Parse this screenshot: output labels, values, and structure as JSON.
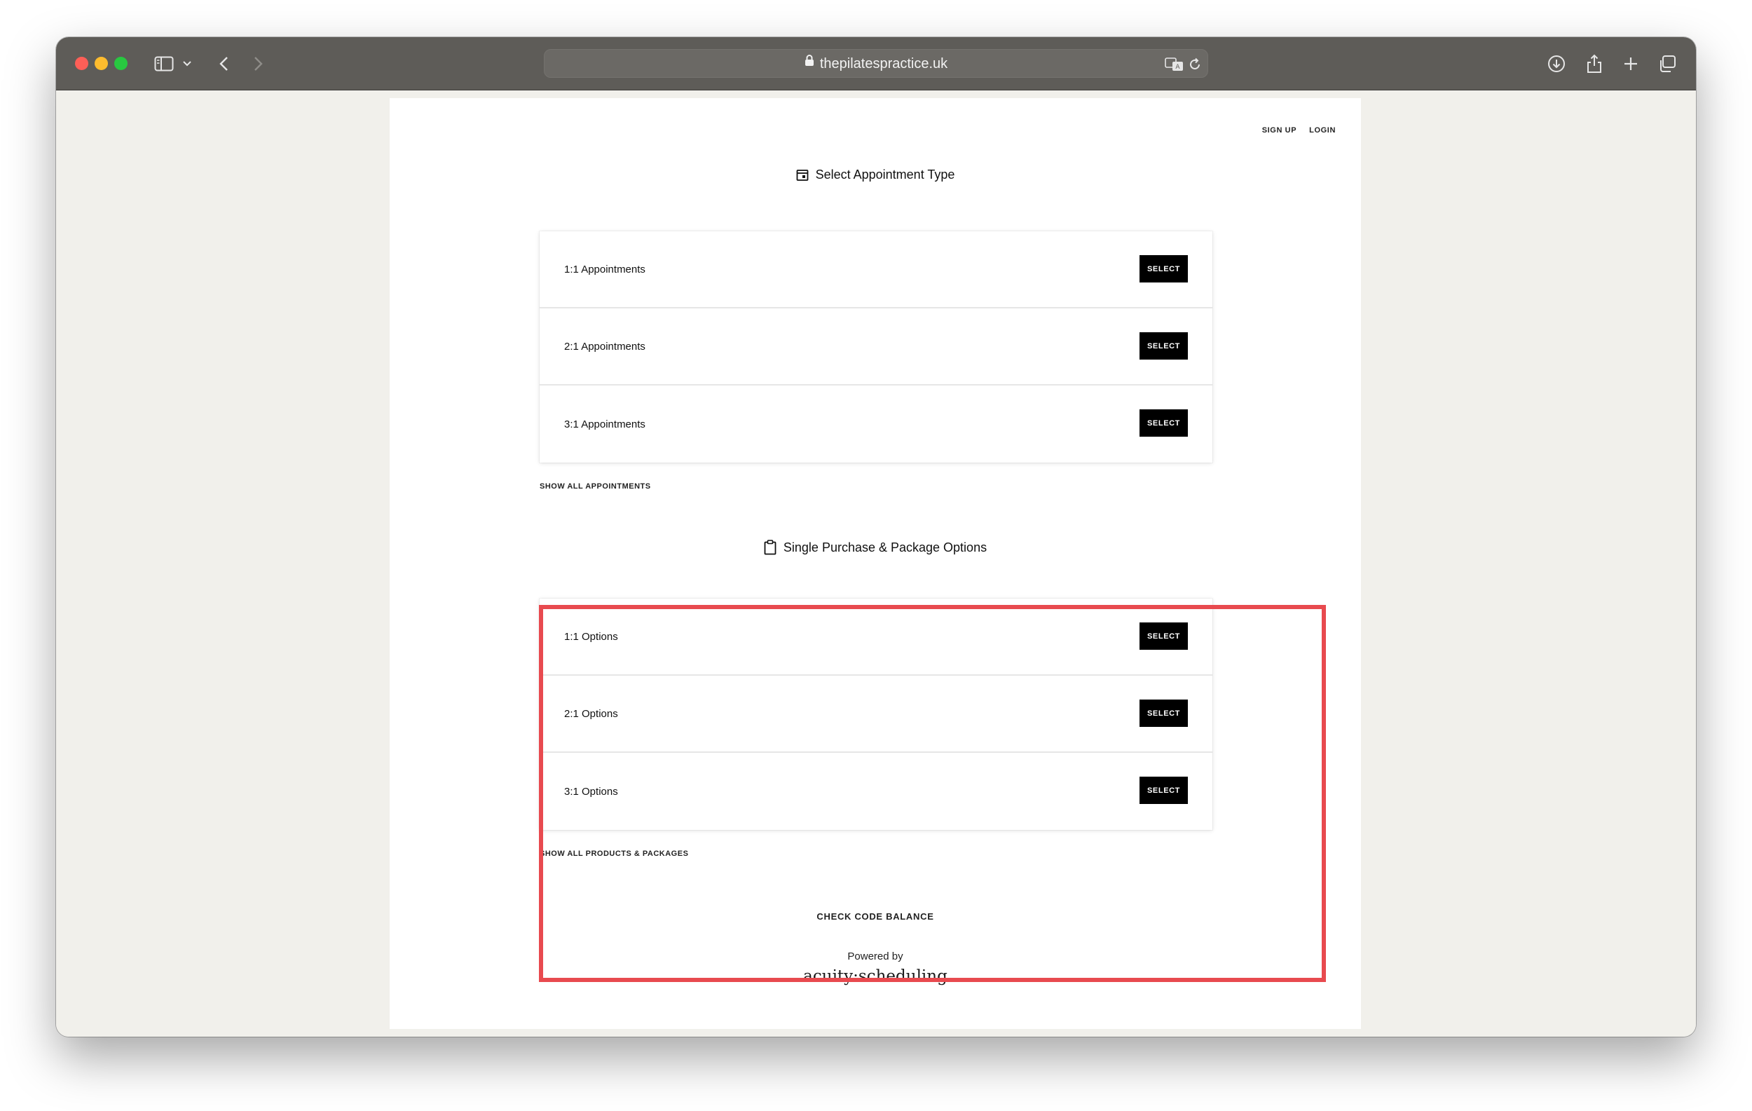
{
  "browser": {
    "url": "thepilatespractice.uk"
  },
  "header": {
    "sign_up": "SIGN UP",
    "login": "LOGIN"
  },
  "appointments": {
    "title": "Select Appointment Type",
    "items": [
      {
        "label": "1:1 Appointments",
        "button": "SELECT"
      },
      {
        "label": "2:1 Appointments",
        "button": "SELECT"
      },
      {
        "label": "3:1 Appointments",
        "button": "SELECT"
      }
    ],
    "show_all": "SHOW ALL APPOINTMENTS"
  },
  "packages": {
    "title": "Single Purchase & Package Options",
    "items": [
      {
        "label": "1:1 Options",
        "button": "SELECT"
      },
      {
        "label": "2:1 Options",
        "button": "SELECT"
      },
      {
        "label": "3:1 Options",
        "button": "SELECT"
      }
    ],
    "show_all": "SHOW ALL PRODUCTS & PACKAGES"
  },
  "footer": {
    "check_code": "CHECK CODE BALANCE",
    "powered_by": "Powered by",
    "brand": "acuity:scheduling"
  },
  "colors": {
    "highlight": "#e84a4f",
    "button_bg": "#000000",
    "page_bg": "#f1f0eb",
    "toolbar_bg": "#5e5c58"
  }
}
